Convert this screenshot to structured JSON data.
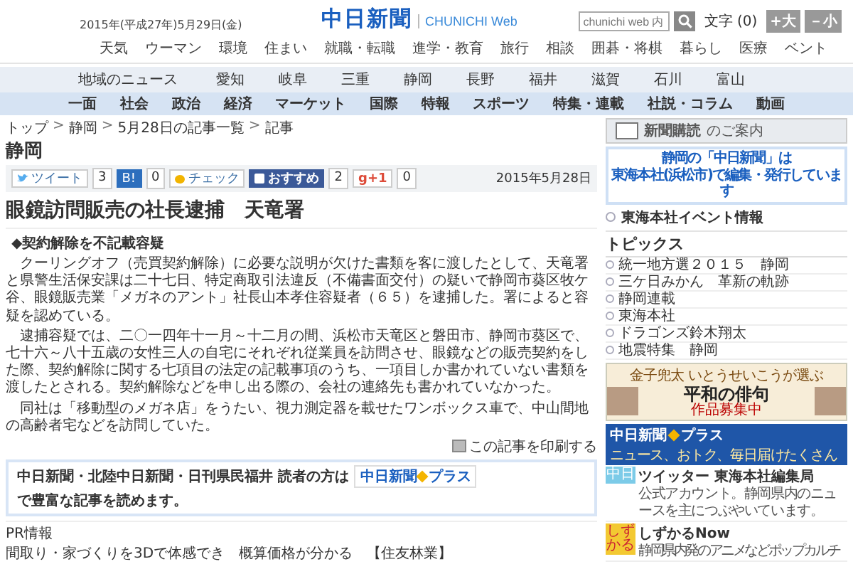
{
  "header": {
    "date": "2015年(平成27年)5月29日(金)",
    "logo": {
      "title": "中日新聞",
      "subtitle": "CHUNICHI Web"
    },
    "search": {
      "placeholder": "chunichi web 内"
    },
    "font_size": {
      "label": "文字",
      "count": "(0)",
      "buttons": [
        "+大",
        "－小"
      ]
    }
  },
  "nav": [
    "天気",
    "ウーマン",
    "環境",
    "住まい",
    "就職・転職",
    "進学・教育",
    "旅行",
    "相談",
    "囲碁・将棋",
    "暮らし",
    "医療",
    "ベント"
  ],
  "region_nav": {
    "label": "地域のニュース",
    "items": [
      "愛知",
      "岐阜",
      "三重",
      "静岡",
      "長野",
      "福井",
      "滋賀",
      "石川",
      "富山"
    ]
  },
  "category_nav": [
    "一面",
    "社会",
    "政治",
    "経済",
    "マーケット",
    "国際",
    "特報",
    "スポーツ",
    "特集・連載",
    "社説・コラム",
    "動画"
  ],
  "breadcrumb": {
    "separator": ">",
    "items": [
      "トップ",
      "静岡",
      "5月28日の記事一覧",
      "記事"
    ]
  },
  "section_title": "静岡",
  "share_bar": {
    "buttons": [
      {
        "kind": "tweet",
        "label": "ツイート",
        "count": "3"
      },
      {
        "kind": "hatena",
        "label": "B!",
        "count": "0"
      },
      {
        "kind": "check",
        "label": "チェック"
      },
      {
        "kind": "facebook",
        "label": "おすすめ",
        "count": "2"
      },
      {
        "kind": "gplus",
        "label": "g+1",
        "count": "0"
      }
    ],
    "date": "2015年5月28日"
  },
  "article": {
    "headline": "眼鏡訪問販売の社長逮捕　天竜署",
    "subheading": "◆契約解除を不記載容疑",
    "paragraphs": [
      "クーリングオフ（売買契約解除）に必要な説明が欠けた書類を客に渡したとして、天竜署と県警生活保安課は二十七日、特定商取引法違反（不備書面交付）の疑いで静岡市葵区牧ケ谷、眼鏡販売業「メガネのアント」社長山本孝住容疑者（６５）を逮捕した。署によると容疑を認めている。",
      "逮捕容疑では、二〇一四年十一月～十二月の間、浜松市天竜区と磐田市、静岡市葵区で、七十六～八十五歳の女性三人の自宅にそれぞれ従業員を訪問させ、眼鏡などの販売契約をした際、契約解除に関する七項目の法定の記載事項のうち、一項目しか書かれていない書類を渡したとされる。契約解除などを申し出る際の、会社の連絡先も書かれていなかった。",
      "同社は「移動型のメガネ店」をうたい、視力測定器を載せたワンボックス車で、中山間地の高齢者宅などを訪問していた。"
    ],
    "print_link": "この記事を印刷する"
  },
  "promo": {
    "before": "中日新聞・北陸中日新聞・日刊県民福井 読者の方は",
    "logo": "中日新聞",
    "logo_suffix": "プラス",
    "after": "で豊富な記事を読めます。"
  },
  "pr": {
    "heading": "PR情報",
    "items": [
      "間取り・家づくりを3Dで体感でき　概算価格が分かる　【住友林業】"
    ]
  },
  "sidebar": {
    "subscribe_banner": {
      "title": "新聞購読",
      "suffix": "のご案内"
    },
    "notice": [
      "静岡の「中日新聞」は",
      "東海本社(浜松市)で編集・発行しています"
    ],
    "event_link": "東海本社イベント情報",
    "topics": {
      "heading": "トピックス",
      "items": [
        "統一地方選２０１５　静岡",
        "三ケ日みかん　革新の軌跡",
        "静岡連載",
        "東海本社",
        "ドラゴンズ鈴木翔太",
        "地震特集　静岡"
      ]
    },
    "haiku_banner": {
      "line_1": "金子兜太 いとうせいこうが選ぶ",
      "title": "平和の俳句",
      "subtitle": "作品募集中"
    },
    "plus_banner": {
      "logo": "中日新聞",
      "suffix": "プラス",
      "tagline": "ニュース、おトク、毎日届けたくさん"
    },
    "features": [
      {
        "kind": "twitter",
        "icon_text": "中日",
        "title": "ツイッター 東海本社編集局",
        "description": "公式アカウント。静岡県内のニュースを主につぶやいています。"
      },
      {
        "kind": "shizukaru",
        "icon_text": "しずかる",
        "title": "しずかるNow",
        "description": "静岡県内発のアニメなどポップカルチ"
      }
    ]
  }
}
